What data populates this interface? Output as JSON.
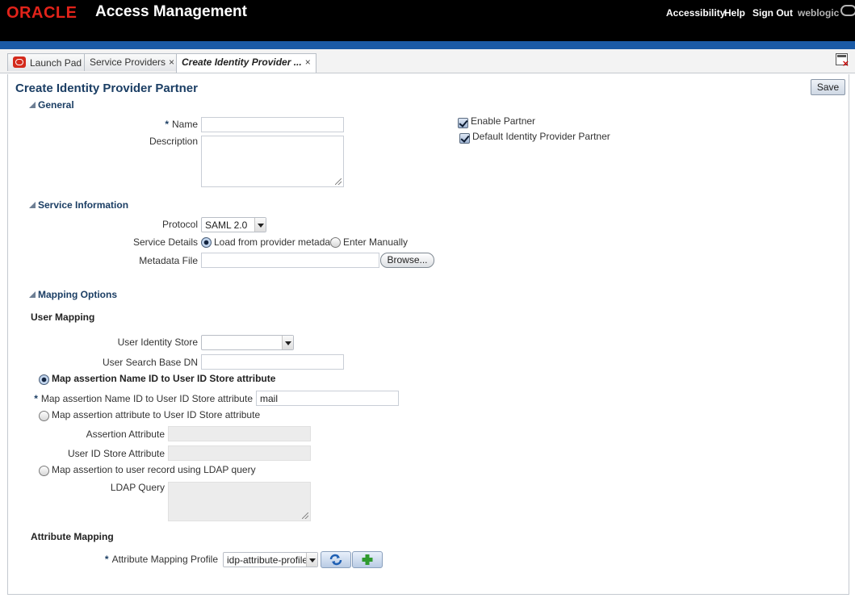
{
  "header": {
    "brand_oracle": "ORACLE",
    "brand_app": "Access Management",
    "links": {
      "accessibility": "Accessibility",
      "help": "Help",
      "sign_out": "Sign Out"
    },
    "user": "weblogic",
    "colors": {
      "bar": "#000000",
      "strip": "#1a5aa6",
      "brand": "#e2231a"
    }
  },
  "tabs": [
    {
      "label": "Launch Pad",
      "icon": "launch-pad-icon",
      "closable": false
    },
    {
      "label": "Service Providers",
      "closable": true
    },
    {
      "label": "Create Identity Provider ...",
      "closable": true,
      "active": true
    }
  ],
  "tab_close_glyph": "×",
  "page": {
    "title": "Create Identity Provider Partner",
    "save_label": "Save"
  },
  "general": {
    "header": "General",
    "name_label": "Name",
    "name_value": "",
    "description_label": "Description",
    "description_value": "",
    "enable_partner_label": "Enable Partner",
    "enable_partner_checked": true,
    "default_idp_label": "Default Identity Provider Partner",
    "default_idp_checked": true
  },
  "service_info": {
    "header": "Service Information",
    "protocol_label": "Protocol",
    "protocol_value": "SAML 2.0",
    "service_details_label": "Service Details",
    "option_load": "Load from provider metadata",
    "option_manual": "Enter Manually",
    "selected": "Load from provider metadata",
    "metadata_file_label": "Metadata File",
    "metadata_file_value": "",
    "browse_label": "Browse..."
  },
  "mapping": {
    "header": "Mapping Options",
    "user_mapping_header": "User Mapping",
    "user_identity_store_label": "User Identity Store",
    "user_identity_store_value": "",
    "user_search_base_dn_label": "User Search Base DN",
    "user_search_base_dn_value": "",
    "opt_name_id": "Map assertion Name ID to User ID Store attribute",
    "name_id_attr_label": "Map assertion Name ID to User ID Store attribute",
    "name_id_attr_value": "mail",
    "opt_attribute": "Map assertion attribute to User ID Store attribute",
    "assertion_attr_label": "Assertion Attribute",
    "assertion_attr_value": "",
    "user_id_store_attr_label": "User ID Store Attribute",
    "user_id_store_attr_value": "",
    "opt_ldap": "Map assertion to user record using LDAP query",
    "ldap_query_label": "LDAP Query",
    "ldap_query_value": "",
    "selected": "Map assertion Name ID to User ID Store attribute"
  },
  "attribute_mapping": {
    "header": "Attribute Mapping",
    "profile_label": "Attribute Mapping Profile",
    "profile_value": "idp-attribute-profile",
    "refresh_icon": "refresh-icon",
    "add_icon": "add-icon"
  },
  "required_marker": "*"
}
